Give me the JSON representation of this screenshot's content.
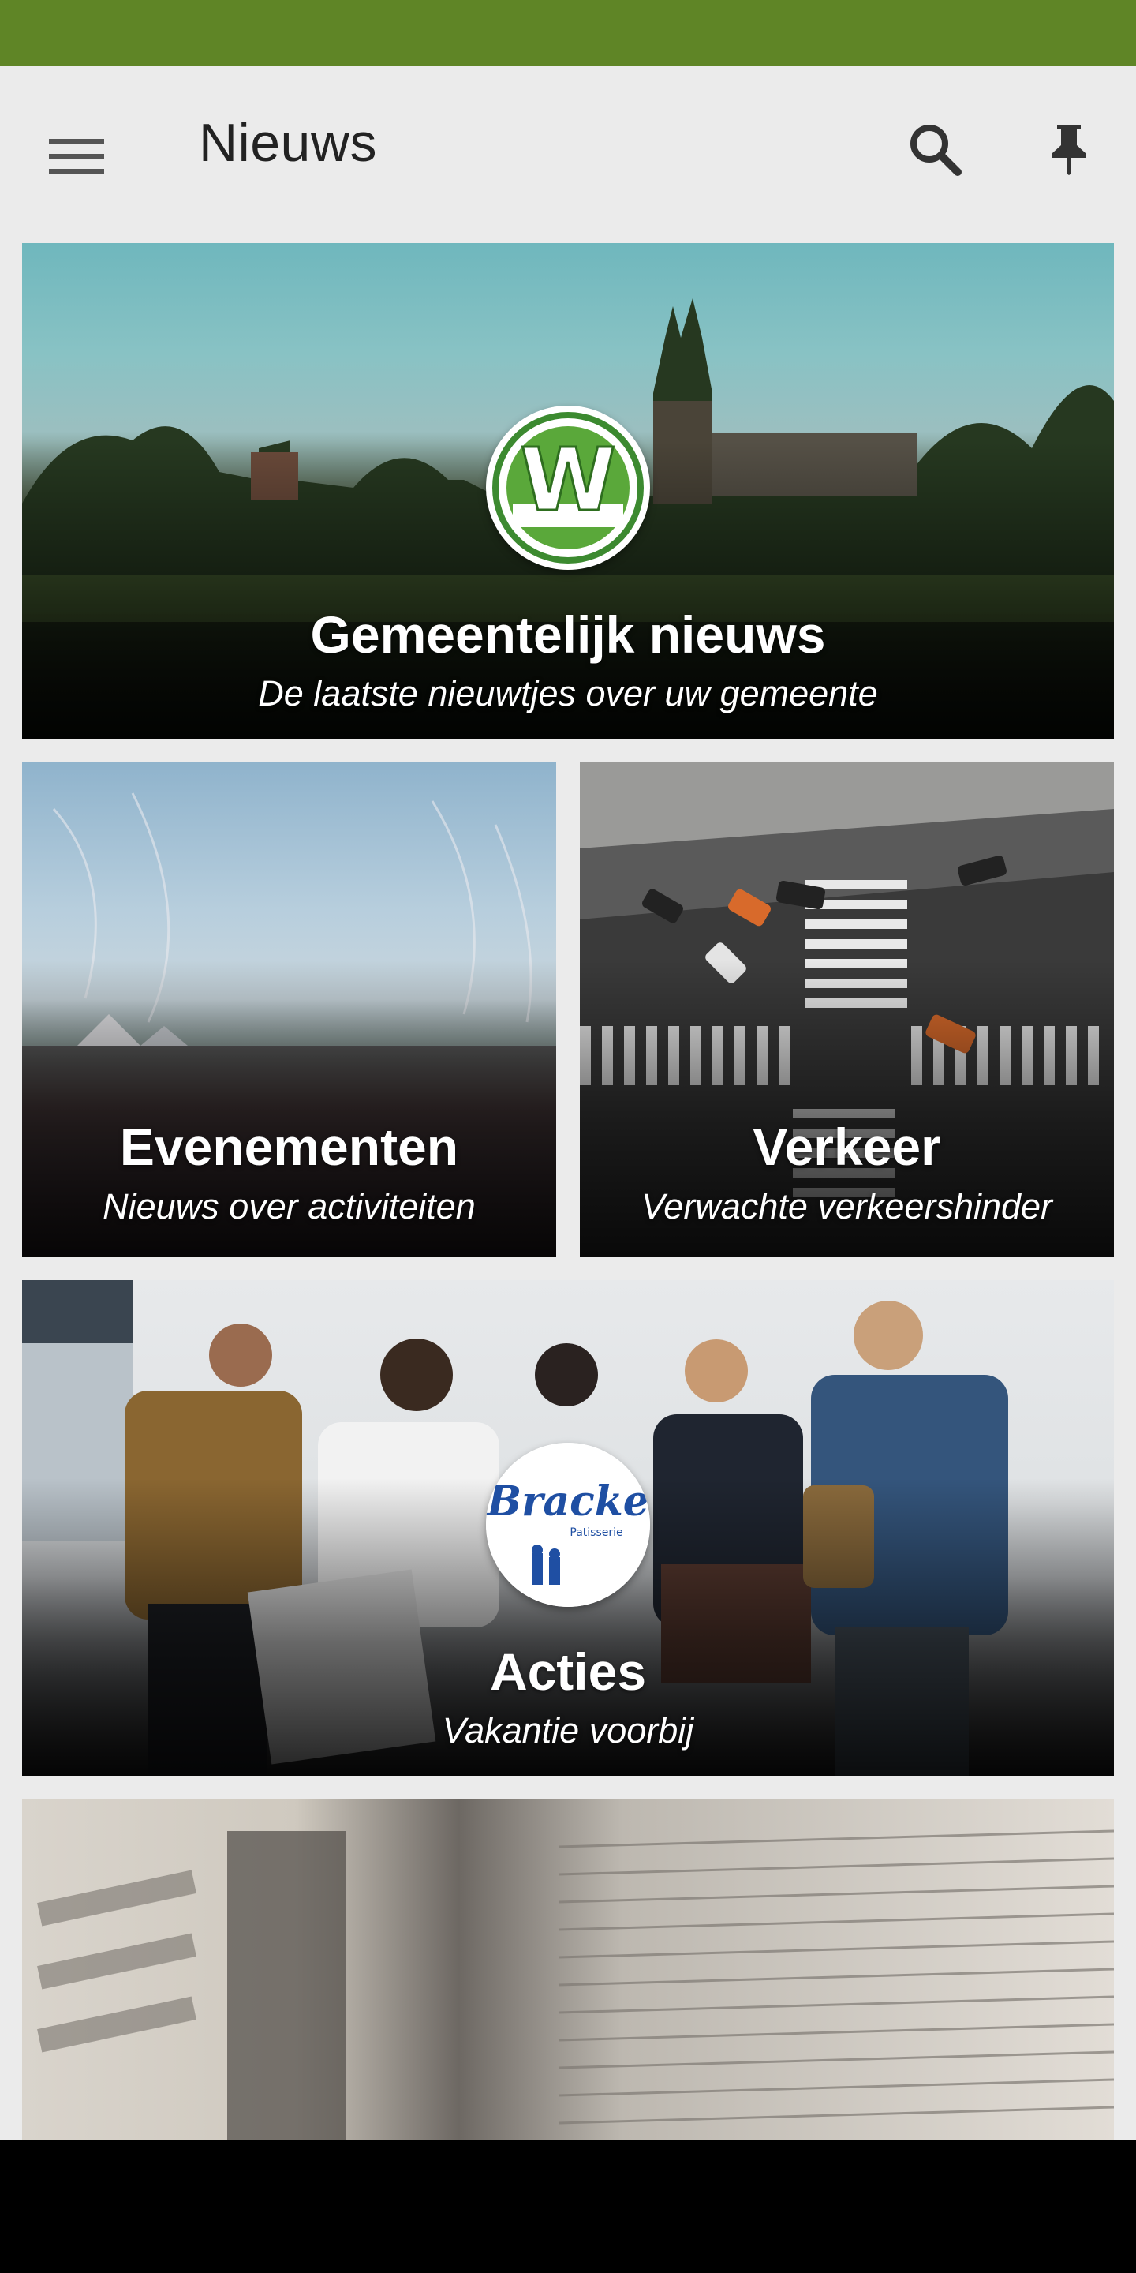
{
  "app_bar": {
    "title": "Nieuws",
    "menu_icon": "menu-icon",
    "search_icon": "search-icon",
    "pin_icon": "pin-icon"
  },
  "colors": {
    "status_bar": "#5f8526",
    "app_bar_bg": "#ebebeb",
    "title_text": "#222222",
    "card_text": "#ffffff"
  },
  "cards": [
    {
      "title": "Gemeentelijk nieuws",
      "subtitle": "De laatste nieuwtjes over uw gemeente",
      "logo_icon": "municipality-w-logo-icon",
      "logo_letter": "W"
    },
    {
      "title": "Evenementen",
      "subtitle": "Nieuws over activiteiten"
    },
    {
      "title": "Verkeer",
      "subtitle": "Verwachte verkeershinder"
    },
    {
      "title": "Acties",
      "subtitle": "Vakantie voorbij",
      "logo_icon": "bracke-patisserie-logo-icon",
      "logo_name": "Bracke",
      "logo_tagline": "Patisserie"
    },
    {
      "title": "",
      "subtitle": ""
    }
  ]
}
